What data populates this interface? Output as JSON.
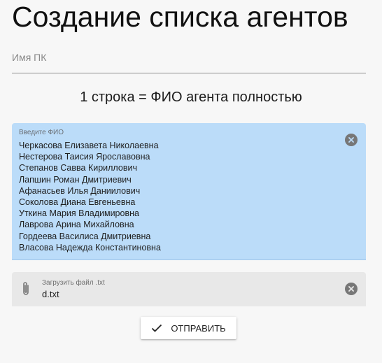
{
  "page": {
    "title": "Создание списка агентов"
  },
  "pc_field": {
    "placeholder": "Имя ПК",
    "value": ""
  },
  "hint": "1 строка = ФИО агента полностью",
  "names_field": {
    "label": "Введите ФИО",
    "names": [
      "Черкасова Елизавета Николаевна",
      "Нестерова Таисия Ярославовна",
      "Степанов Савва Кириллович",
      "Лапшин Роман Дмитриевич",
      "Афанасьев Илья Даниилович",
      "Соколова Диана Евгеньевна",
      "Уткина Мария Владимировна",
      "Лаврова Арина Михайловна",
      "Гордеева Василиса Дмитриевна",
      "Власова Надежда Константиновна"
    ]
  },
  "file_field": {
    "label": "Загрузить файл .txt",
    "value": "d.txt"
  },
  "submit_button": {
    "label": "ОТПРАВИТЬ"
  },
  "colors": {
    "names_bg": "#bbdcf9",
    "file_bg": "#e8e8e8",
    "page_bg": "#f7f7f7"
  }
}
